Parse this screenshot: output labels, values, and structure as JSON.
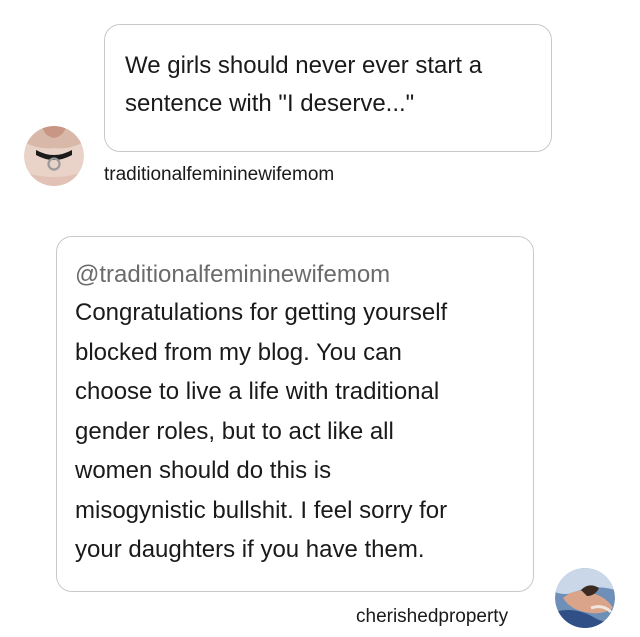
{
  "thread": {
    "message_1": {
      "text": "We girls should never ever start a\nsentence with \"I deserve...\"",
      "author": "traditionalfemininewifemom",
      "avatar": "choker-necklace-avatar"
    },
    "message_2": {
      "mention": "@traditionalfemininewifemom",
      "text": "Congratulations for getting yourself\nblocked from my blog. You can\nchoose to live a life with traditional\ngender roles, but to act like all\nwomen should do this is\nmisogynistic bullshit. I feel sorry for\nyour daughters if you have them.",
      "author": "cherishedproperty",
      "avatar": "painting-avatar"
    }
  },
  "colors": {
    "bubble_border": "#c9c9c9",
    "text": "#1a1a1a",
    "mention": "#6b6b6b",
    "background": "#ffffff"
  }
}
